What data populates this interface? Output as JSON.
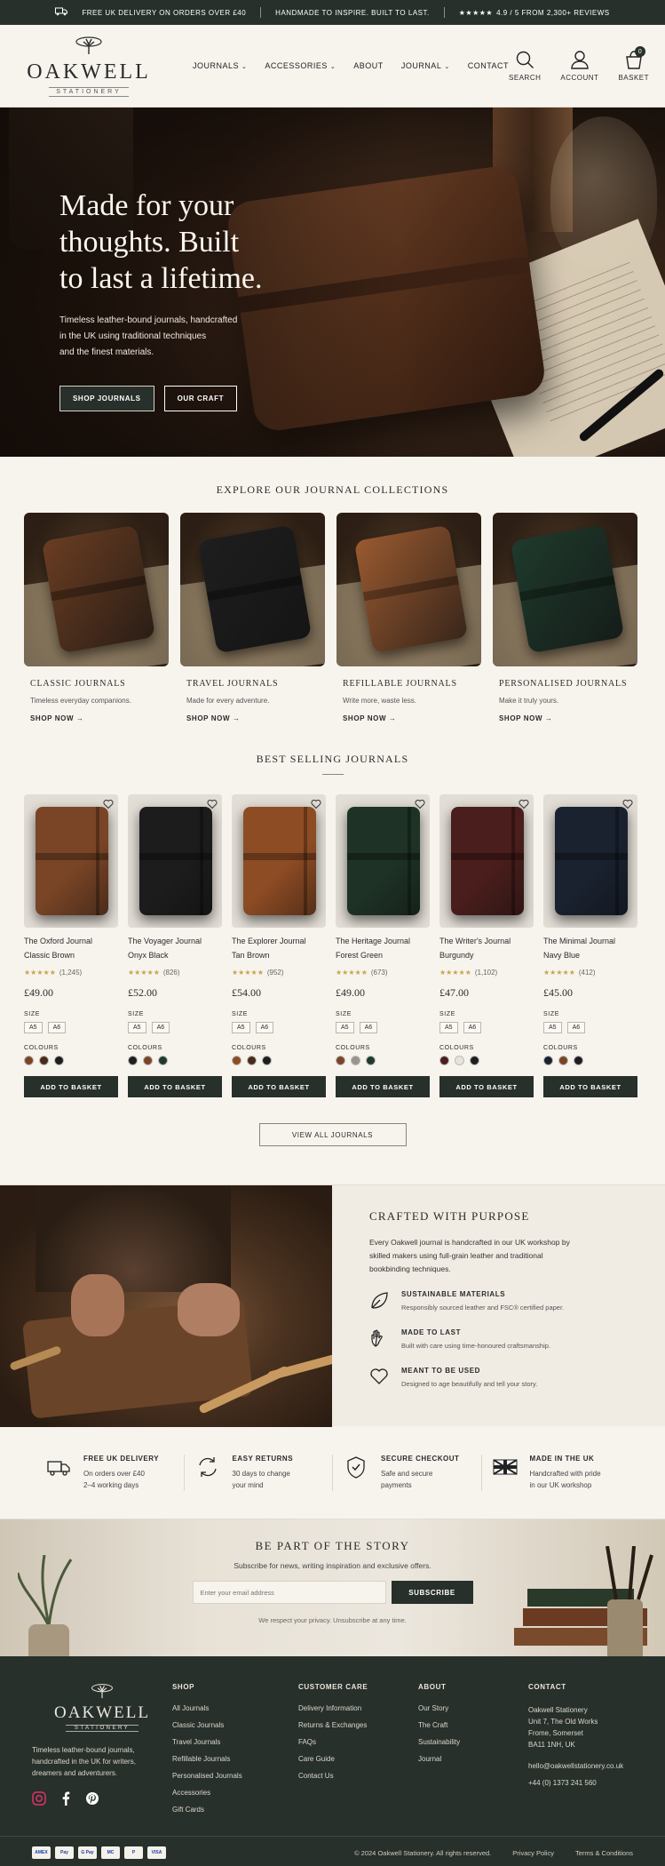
{
  "topbar": {
    "delivery": "FREE UK DELIVERY ON ORDERS OVER £40",
    "handmade": "HANDMADE TO INSPIRE. BUILT TO LAST.",
    "stars": "★★★★★",
    "reviews": "4.9 / 5 FROM 2,300+ REVIEWS"
  },
  "header": {
    "brand": "OAKWELL",
    "brand_sub": "STATIONERY",
    "nav": [
      "JOURNALS",
      "ACCESSORIES",
      "ABOUT",
      "JOURNAL",
      "CONTACT"
    ],
    "nav_dropdown": [
      true,
      true,
      false,
      true,
      false
    ],
    "icons": {
      "search": "SEARCH",
      "account": "ACCOUNT",
      "basket": "BASKET"
    },
    "basket_count": "0"
  },
  "hero": {
    "line1": "Made for your",
    "line2": "thoughts. Built",
    "line3": "to last a lifetime.",
    "p1": "Timeless leather-bound journals, handcrafted",
    "p2": "in the UK using traditional techniques",
    "p3": "and the finest materials.",
    "cta1": "SHOP JOURNALS",
    "cta2": "OUR CRAFT"
  },
  "collections": {
    "title": "EXPLORE OUR JOURNAL COLLECTIONS",
    "link": "SHOP NOW →",
    "items": [
      {
        "name": "CLASSIC JOURNALS",
        "desc": "Timeless everyday companions.",
        "color": "#6a3d22"
      },
      {
        "name": "TRAVEL JOURNALS",
        "desc": "Made for every adventure.",
        "color": "#1e1e1e"
      },
      {
        "name": "REFILLABLE JOURNALS",
        "desc": "Write more, waste less.",
        "color": "#9a5a30"
      },
      {
        "name": "PERSONALISED JOURNALS",
        "desc": "Make it truly yours.",
        "color": "#1f3a2c"
      }
    ]
  },
  "best": {
    "title": "BEST SELLING JOURNALS",
    "size_label": "SIZE",
    "colour_label": "COLOURS",
    "sizes": [
      "A5",
      "A6"
    ],
    "add": "ADD TO BASKET",
    "view_all": "VIEW ALL JOURNALS",
    "products": [
      {
        "name": "The Oxford Journal",
        "variant": "Classic Brown",
        "stars": "★★★★★",
        "reviews": "(1,245)",
        "price": "£49.00",
        "color": "#7a4526",
        "swatches": [
          "#7a4526",
          "#4a2a18",
          "#1e1e1e"
        ]
      },
      {
        "name": "The Voyager Journal",
        "variant": "Onyx Black",
        "stars": "★★★★★",
        "reviews": "(826)",
        "price": "£52.00",
        "color": "#1c1c1c",
        "swatches": [
          "#1e1e1e",
          "#7a4526",
          "#1f3a2c"
        ]
      },
      {
        "name": "The Explorer Journal",
        "variant": "Tan Brown",
        "stars": "★★★★★",
        "reviews": "(952)",
        "price": "£54.00",
        "color": "#8e4c24",
        "swatches": [
          "#8e4c24",
          "#4a2a18",
          "#1e1e1e"
        ]
      },
      {
        "name": "The Heritage Journal",
        "variant": "Forest Green",
        "stars": "★★★★★",
        "reviews": "(673)",
        "price": "£49.00",
        "color": "#1e3326",
        "swatches": [
          "#7a4526",
          "#9a948a",
          "#1f3a2c"
        ]
      },
      {
        "name": "The Writer's Journal",
        "variant": "Burgundy",
        "stars": "★★★★★",
        "reviews": "(1,102)",
        "price": "£47.00",
        "color": "#4a1e1c",
        "swatches": [
          "#4a1e1c",
          "#e8e2d8",
          "#1e1e1e"
        ]
      },
      {
        "name": "The Minimal Journal",
        "variant": "Navy Blue",
        "stars": "★★★★★",
        "reviews": "(412)",
        "price": "£45.00",
        "color": "#1a2230",
        "swatches": [
          "#1a2230",
          "#7a4526",
          "#1e1e1e"
        ]
      }
    ]
  },
  "craft": {
    "title": "CRAFTED WITH PURPOSE",
    "desc": "Every Oakwell journal is handcrafted in our UK workshop by skilled makers using full-grain leather and traditional bookbinding techniques.",
    "features": [
      {
        "icon": "leaf-icon",
        "title": "SUSTAINABLE MATERIALS",
        "desc": "Responsibly sourced leather and FSC® certified paper."
      },
      {
        "icon": "hand-icon",
        "title": "MADE TO LAST",
        "desc": "Built with care using time-honoured craftsmanship."
      },
      {
        "icon": "heart-icon",
        "title": "MEANT TO BE USED",
        "desc": "Designed to age beautifully and tell your story."
      }
    ]
  },
  "usp": [
    {
      "icon": "truck-icon",
      "title": "FREE UK DELIVERY",
      "l1": "On orders over £40",
      "l2": "2–4 working days"
    },
    {
      "icon": "returns-icon",
      "title": "EASY RETURNS",
      "l1": "30 days to change",
      "l2": "your mind"
    },
    {
      "icon": "shield-icon",
      "title": "SECURE CHECKOUT",
      "l1": "Safe and secure",
      "l2": "payments"
    },
    {
      "icon": "uk-flag-icon",
      "title": "MADE IN THE UK",
      "l1": "Handcrafted with pride",
      "l2": "in our UK workshop"
    }
  ],
  "newsletter": {
    "title": "BE PART OF THE STORY",
    "sub": "Subscribe for news, writing inspiration and exclusive offers.",
    "placeholder": "Enter your email address",
    "button": "SUBSCRIBE",
    "privacy": "We respect your privacy. Unsubscribe at any time."
  },
  "footer": {
    "brand": "OAKWELL",
    "brand_sub": "STATIONERY",
    "tagline": "Timeless leather-bound journals, handcrafted in the UK for writers, dreamers and adventurers.",
    "shop_title": "SHOP",
    "shop": [
      "All Journals",
      "Classic Journals",
      "Travel Journals",
      "Refillable Journals",
      "Personalised Journals",
      "Accessories",
      "Gift Cards"
    ],
    "care_title": "CUSTOMER CARE",
    "care": [
      "Delivery Information",
      "Returns & Exchanges",
      "FAQs",
      "Care Guide",
      "Contact Us"
    ],
    "about_title": "ABOUT",
    "about": [
      "Our Story",
      "The Craft",
      "Sustainability",
      "Journal"
    ],
    "contact_title": "CONTACT",
    "address": [
      "Oakwell Stationery",
      "Unit 7, The Old Works",
      "Frome, Somerset",
      "BA11 1NH, UK"
    ],
    "email": "hello@oakwellstationery.co.uk",
    "phone": "+44 (0) 1373 241 560",
    "payments": [
      "AMEX",
      "Pay",
      "G Pay",
      "MC",
      "P",
      "VISA"
    ],
    "copyright": "© 2024 Oakwell Stationery. All rights reserved.",
    "privacy": "Privacy Policy",
    "terms": "Terms & Conditions"
  }
}
